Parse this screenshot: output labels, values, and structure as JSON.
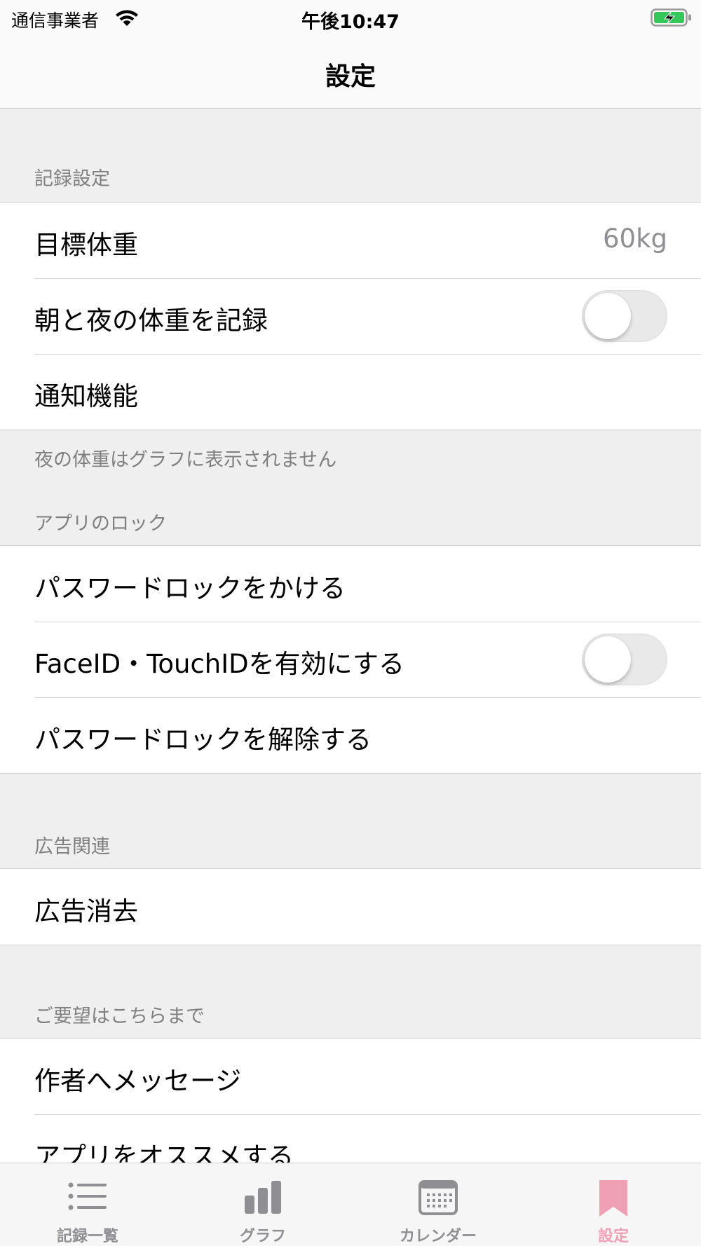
{
  "status_bar": {
    "carrier": "通信事業者",
    "time": "午後10:47"
  },
  "nav": {
    "title": "設定"
  },
  "sections": {
    "record": {
      "header": "記録設定",
      "target_weight_label": "目標体重",
      "target_weight_value": "60kg",
      "morning_night_label": "朝と夜の体重を記録",
      "morning_night_on": false,
      "notification_label": "通知機能",
      "footer": "夜の体重はグラフに表示されません"
    },
    "lock": {
      "header": "アプリのロック",
      "password_lock_label": "パスワードロックをかける",
      "faceid_label": "FaceID・TouchIDを有効にする",
      "faceid_on": false,
      "password_unlock_label": "パスワードロックを解除する"
    },
    "ads": {
      "header": "広告関連",
      "remove_ads_label": "広告消去"
    },
    "feedback": {
      "header": "ご要望はこちらまで",
      "message_label": "作者へメッセージ",
      "recommend_label": "アプリをオススメする"
    }
  },
  "tab_bar": {
    "items": [
      {
        "label": "記録一覧",
        "icon": "list-icon"
      },
      {
        "label": "グラフ",
        "icon": "bar-chart-icon"
      },
      {
        "label": "カレンダー",
        "icon": "calendar-icon"
      },
      {
        "label": "設定",
        "icon": "bookmark-icon",
        "active": true
      }
    ],
    "active_color": "#f0a0b4",
    "inactive_color": "#8e8e93"
  }
}
